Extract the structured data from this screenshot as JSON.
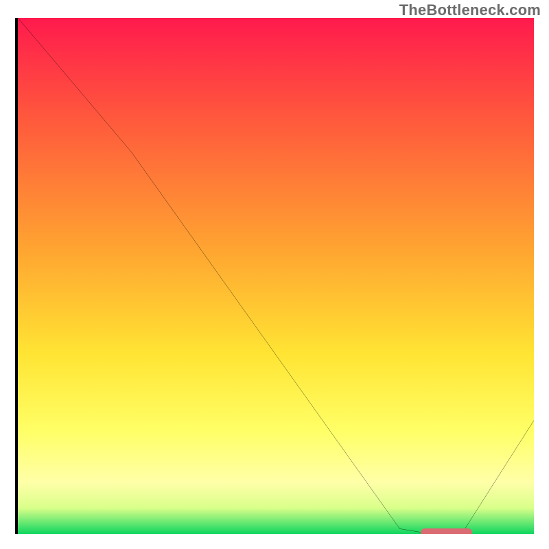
{
  "attribution": "TheBottleneck.com",
  "chart_data": {
    "type": "line",
    "title": "",
    "xlabel": "",
    "ylabel": "",
    "xlim": [
      0,
      100
    ],
    "ylim": [
      0,
      100
    ],
    "grid": false,
    "legend": false,
    "background_gradient": {
      "stops": [
        {
          "pct": 0,
          "color": "#ff1a4d"
        },
        {
          "pct": 20,
          "color": "#ff5a3c"
        },
        {
          "pct": 45,
          "color": "#ffa531"
        },
        {
          "pct": 65,
          "color": "#ffe433"
        },
        {
          "pct": 80,
          "color": "#ffff66"
        },
        {
          "pct": 90,
          "color": "#ffffa8"
        },
        {
          "pct": 95,
          "color": "#d9ff8a"
        },
        {
          "pct": 100,
          "color": "#0fd65f"
        }
      ]
    },
    "series": [
      {
        "name": "bottleneck-curve",
        "x": [
          0,
          22,
          74,
          80,
          86,
          100
        ],
        "y": [
          100,
          74,
          1,
          0,
          0,
          22
        ]
      }
    ],
    "highlight_marker": {
      "x_start": 78,
      "x_end": 88,
      "y": 0,
      "color": "#db6b72"
    }
  }
}
